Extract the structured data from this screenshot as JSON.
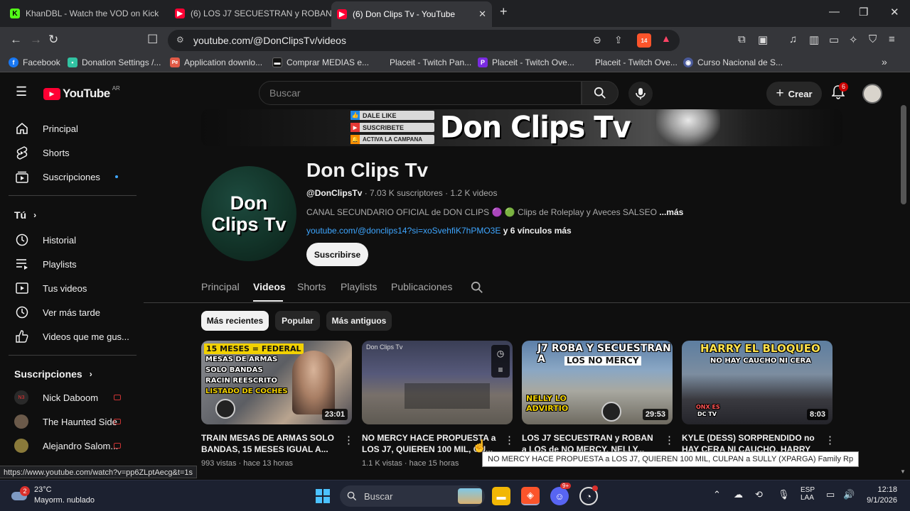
{
  "browser": {
    "tabs": [
      {
        "title": "KhanDBL - Watch the VOD on Kick",
        "favicon": "kick-icon",
        "color": "#53fc18"
      },
      {
        "title": "(6) LOS J7 SECUESTRAN y ROBAN a L",
        "favicon": "youtube-icon",
        "color": "#ff0033"
      },
      {
        "title": "(6) Don Clips Tv - YouTube",
        "favicon": "youtube-icon",
        "color": "#ff0033"
      }
    ],
    "url": "youtube.com/@DonClipsTv/videos",
    "shield_count": "14",
    "bookmarks": [
      {
        "label": "Facebook",
        "icon": "facebook-icon",
        "color": "#1877f2"
      },
      {
        "label": "Donation Settings /...",
        "icon": "streamlabs-icon",
        "color": "#31c3a2"
      },
      {
        "label": "Application downlo...",
        "icon": "placeit-icon",
        "color": "#e05a47"
      },
      {
        "label": "Comprar MEDIAS e...",
        "icon": "media-icon",
        "color": "#222"
      },
      {
        "label": "Placeit - Twitch Pan...",
        "icon": "placeit-icon",
        "color": "#f2f2f2"
      },
      {
        "label": "Placeit - Twitch Ove...",
        "icon": "placeit-p-icon",
        "color": "#7a2be2"
      },
      {
        "label": "Placeit - Twitch Ove...",
        "icon": "placeit-icon",
        "color": "#f2f2f2"
      },
      {
        "label": "Curso Nacional de S...",
        "icon": "globe-icon",
        "color": "#4a5a9a"
      }
    ]
  },
  "youtube": {
    "logo_text": "YouTube",
    "region": "AR",
    "search_placeholder": "Buscar",
    "create_label": "Crear",
    "notification_count": "6",
    "sidebar": {
      "main": [
        {
          "label": "Principal",
          "icon": "home-icon"
        },
        {
          "label": "Shorts",
          "icon": "shorts-icon"
        },
        {
          "label": "Suscripciones",
          "icon": "subscriptions-icon"
        }
      ],
      "you_heading": "Tú",
      "you_items": [
        {
          "label": "Historial",
          "icon": "history-icon"
        },
        {
          "label": "Playlists",
          "icon": "playlists-icon"
        },
        {
          "label": "Tus videos",
          "icon": "your-videos-icon"
        },
        {
          "label": "Ver más tarde",
          "icon": "watch-later-icon"
        },
        {
          "label": "Videos que me gus...",
          "icon": "like-icon"
        }
      ],
      "subs_heading": "Suscripciones",
      "subs": [
        {
          "label": "Nick Daboom",
          "color": "#333"
        },
        {
          "label": "The Haunted Side",
          "color": "#6b5a4a"
        },
        {
          "label": "Alejandro Salom...",
          "color": "#8a7a3a"
        }
      ]
    },
    "channel": {
      "banner_stickers": [
        "DALE LIKE",
        "SUSCRIBETE",
        "ACTIVA LA CAMPANA"
      ],
      "banner_title": "Don Clips Tv",
      "avatar_text": "Don Clips Tv",
      "name": "Don Clips Tv",
      "handle": "@DonClipsTv",
      "stats": "· 7.03 K suscriptores · 1.2 K videos",
      "description": "CANAL SECUNDARIO OFICIAL de DON CLIPS 🟣 🟢 Clips de Roleplay y Aveces SALSEO",
      "more_label": "...más",
      "link": "youtube.com/@donclips14?si=xoSvehfiK7hPMO3E",
      "link_more": "y 6 vínculos más",
      "subscribe_label": "Suscribirse"
    },
    "tabs": [
      "Principal",
      "Videos",
      "Shorts",
      "Playlists",
      "Publicaciones"
    ],
    "active_tab": "Videos",
    "chips": [
      "Más recientes",
      "Popular",
      "Más antiguos"
    ],
    "videos": [
      {
        "title": "TRAIN MESAS DE ARMAS SOLO BANDAS, 15 MESES IGUAL A...",
        "meta": "993 vistas · hace 13 horas",
        "duration": "23:01",
        "thumb_lines": [
          "15 MESES = FEDERAL",
          "MESAS DE ARMAS",
          "SOLO BANDAS",
          "RACIN REESCRITO",
          "LISTADO DE COCHES"
        ]
      },
      {
        "title": "NO MERCY HACE PROPUESTA a LOS J7, QUIEREN 100 MIL, CU...",
        "meta": "1.1 K vistas · hace 15 horas",
        "duration": "",
        "thumb_lines": [
          "Don Clips Tv"
        ]
      },
      {
        "title": "LOS J7 SECUESTRAN y ROBAN a LOS de NO MERCY, NELLY...",
        "meta": "",
        "duration": "29:53",
        "thumb_lines": [
          "J7 ROBA Y SECUESTRAN A",
          "LOS NO MERCY",
          "NELLY LO",
          "ADVIRTIO"
        ]
      },
      {
        "title": "KYLE (DESS) SORPRENDIDO no HAY CERA NI CAUCHO, HARRY EL...",
        "meta": "",
        "duration": "8:03",
        "thumb_lines": [
          "HARRY EL BLOQUEO",
          "NO HAY CAUCHO NI CERA",
          "ONX ES",
          "DC TV"
        ]
      }
    ],
    "tooltip": "NO MERCY HACE PROPUESTA a LOS J7, QUIEREN 100 MIL, CULPAN a SULLY (XPARGA) Family Rp",
    "status_url": "https://www.youtube.com/watch?v=pp6ZLptAecg&t=1s"
  },
  "taskbar": {
    "weather_temp": "23°C",
    "weather_desc": "Mayorm. nublado",
    "weather_badge": "2",
    "search_placeholder": "Buscar",
    "lang_top": "ESP",
    "lang_bottom": "LAA",
    "time": "12:18",
    "date": "9/1/2026",
    "discord_badge": "9+"
  }
}
